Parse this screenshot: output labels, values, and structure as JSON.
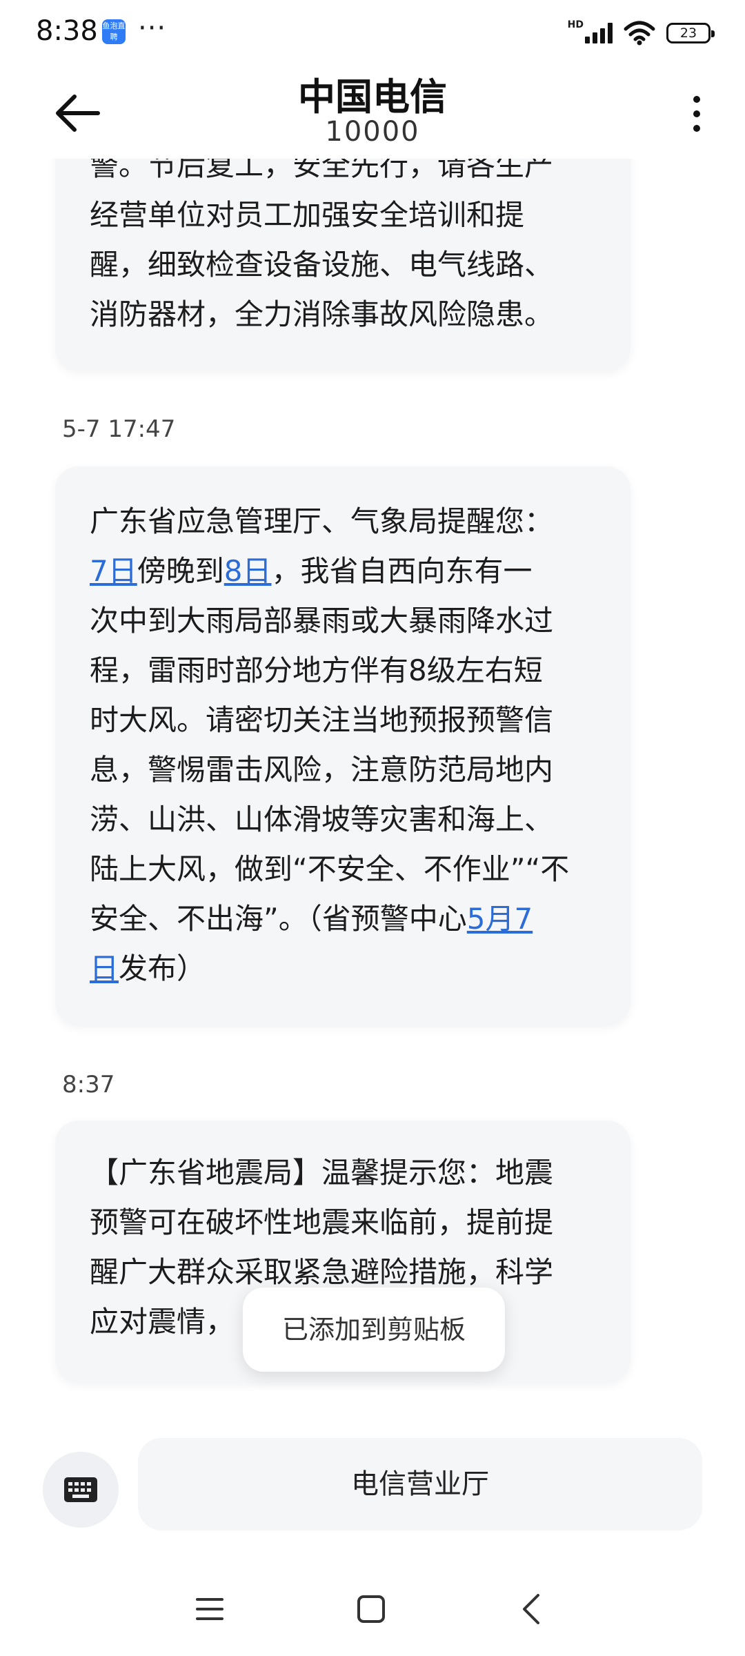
{
  "status_bar": {
    "time": "8:38",
    "notification_app_text": "鱼泡直聘",
    "more": "···",
    "hd": "HD",
    "battery": "23"
  },
  "header": {
    "title": "中国电信",
    "number": "10000"
  },
  "messages": {
    "first_partial": {
      "line0": "警。节后复工，安全先行，请各生产",
      "line1": "经营单位对员工加强安全培训和提",
      "line2": "醒，细致检查设备设施、电气线路、",
      "line3": "消防器材，全力消除事故风险隐患。"
    },
    "second": {
      "timestamp": "5-7 17:47",
      "line1": "广东省应急管理厅、气象局提醒您：",
      "line2_link1": "7日",
      "line2_mid": "傍晚到",
      "line2_link2": "8日",
      "line2_tail": "，我省自西向东有一",
      "line3": "次中到大雨局部暴雨或大暴雨降水过",
      "line4": "程，雷雨时部分地方伴有8级左右短",
      "line5": "时大风。请密切关注当地预报预警信",
      "line6": "息，警惕雷击风险，注意防范局地内",
      "line7": "涝、山洪、山体滑坡等灾害和海上、",
      "line8": "陆上大风，做到“不安全、不作业”“不",
      "line9_head": "安全、不出海”。（省预警中心",
      "line9_link": "5月7",
      "line10_link": "日",
      "line10_tail": "发布）"
    },
    "third": {
      "timestamp": "8:37",
      "line1": "【广东省地震局】温馨提示您：地震",
      "line2": "预警可在破坏性地震来临前，提前提",
      "line3": "醒广大群众采取紧急避险措施，科学",
      "line4": "应对震情，"
    }
  },
  "toast": "已添加到剪贴板",
  "input_area": {
    "keyboard_icon": "keyboard-icon",
    "shortcut_label": "电信营业厅"
  },
  "nav_icons": [
    "menu-icon",
    "home-square-icon",
    "back-chevron-icon"
  ],
  "colors": {
    "link": "#2b6cd6",
    "bubble": "#f5f6f8",
    "background": "#ffffff"
  }
}
